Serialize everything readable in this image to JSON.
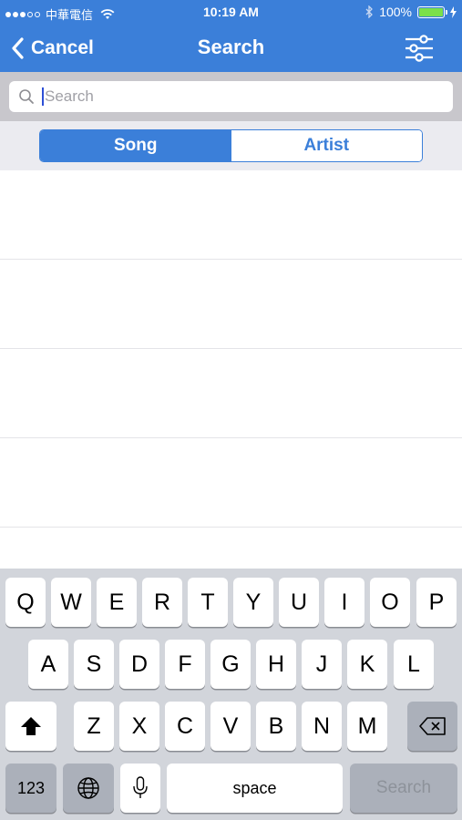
{
  "status_bar": {
    "carrier": "中華電信",
    "time": "10:19 AM",
    "battery": "100%",
    "signal_bars_filled": 3,
    "signal_bars_total": 5
  },
  "nav": {
    "back_label": "Cancel",
    "title": "Search",
    "back_icon": "chevron-left-icon",
    "filter_icon": "sliders-icon"
  },
  "search": {
    "value": "",
    "placeholder": "Search"
  },
  "segments": {
    "song": "Song",
    "artist": "Artist",
    "selected": "Song"
  },
  "results": {
    "rows": [
      "",
      "",
      "",
      ""
    ]
  },
  "keyboard": {
    "row1": [
      "Q",
      "W",
      "E",
      "R",
      "T",
      "Y",
      "U",
      "I",
      "O",
      "P"
    ],
    "row2": [
      "A",
      "S",
      "D",
      "F",
      "G",
      "H",
      "J",
      "K",
      "L"
    ],
    "row3": [
      "Z",
      "X",
      "C",
      "V",
      "B",
      "N",
      "M"
    ],
    "numbers_key": "123",
    "space_key": "space",
    "search_key": "Search"
  },
  "colors": {
    "accent": "#3b7fd9",
    "battery": "#7be04a"
  }
}
